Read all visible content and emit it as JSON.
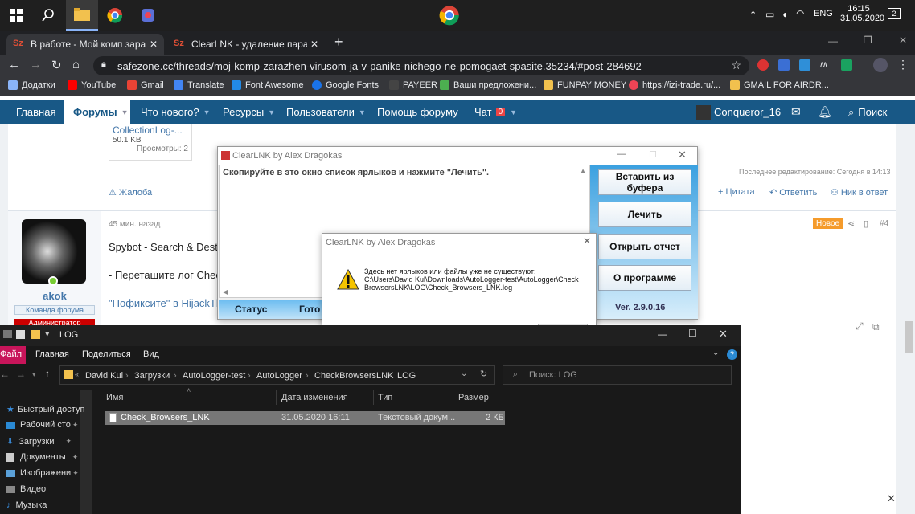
{
  "taskbar": {
    "clock_time": "16:15",
    "clock_date": "31.05.2020",
    "lang": "ENG",
    "notif_count": "2"
  },
  "browser": {
    "tabs": [
      {
        "label": "В работе - Мой комп заражен ..."
      },
      {
        "label": "ClearLNK - удаление параметр..."
      }
    ],
    "url": "safezone.cc/threads/moj-komp-zarazhen-virusom-ja-v-panike-nichego-ne-pomogaet-spasite.35234/#post-284692",
    "bookmarks": [
      "Додатки",
      "YouTube",
      "Gmail",
      "Translate",
      "Font Awesome",
      "Google Fonts",
      "PAYEER",
      "Ваши предложени...",
      "FUNPAY MONEY",
      "https://izi-trade.ru/...",
      "GMAIL FOR AIRDR..."
    ]
  },
  "site_nav": {
    "items": [
      "Главная",
      "Форумы",
      "Что нового?",
      "Ресурсы",
      "Пользователи",
      "Помощь форуму",
      "Чат"
    ],
    "chat_badge": "0",
    "user": "Conqueror_16",
    "search": "Поиск"
  },
  "post_prev": {
    "attachment_name": "CollectionLog-...",
    "attachment_size": "50.1 KB",
    "views": "Просмотры: 2",
    "edited": "Последнее редактирование: Сегодня в 14:13",
    "report": "Жалоба",
    "quote": "+ Цитата",
    "reply": "Ответить",
    "reply_to": "Ник в ответ"
  },
  "post": {
    "time": "45 мин. назад",
    "new_badge": "Новое",
    "number": "#4",
    "author": "akok",
    "role": "Команда форума",
    "role2": "Администратор",
    "line1": "Spybot - Search & Destro",
    "line2": "- Перетащите лог Check",
    "line3": "\"Пофиксите\" в HijackThi"
  },
  "clearlnk": {
    "title": "ClearLNK by Alex Dragokas",
    "instruction": "Скопируйте в это окно список ярлыков и нажмите \"Лечить\".",
    "btn_paste": "Вставить из буфера",
    "btn_cure": "Лечить",
    "btn_report": "Открыть отчет",
    "btn_about": "О программе",
    "version": "Ver. 2.9.0.16",
    "status_label": "Статус",
    "status_value": "Гото"
  },
  "msgbox": {
    "title": "ClearLNK by Alex Dragokas",
    "text": "Здесь нет ярлыков или файлы уже не существуют:",
    "path": "C:\\Users\\David Kul\\Downloads\\AutoLogger-test\\AutoLogger\\CheckBrowsersLNK\\LOG\\Check_Browsers_LNK.log"
  },
  "explorer": {
    "title": "LOG",
    "ribbon": [
      "Файл",
      "Главная",
      "Поделиться",
      "Вид"
    ],
    "breadcrumbs": [
      "David Kul",
      "Загрузки",
      "AutoLogger-test",
      "AutoLogger",
      "CheckBrowsersLNK",
      "LOG"
    ],
    "search_placeholder": "Поиск: LOG",
    "columns": [
      "Имя",
      "Дата изменения",
      "Тип",
      "Размер"
    ],
    "files": [
      {
        "name": "Check_Browsers_LNK",
        "date": "31.05.2020 16:11",
        "type": "Текстовый докум...",
        "size": "2 КБ"
      }
    ],
    "sidebar": [
      "Быстрый доступ",
      "Рабочий сто",
      "Загрузки",
      "Документы",
      "Изображени",
      "Видео",
      "Музыка"
    ]
  }
}
